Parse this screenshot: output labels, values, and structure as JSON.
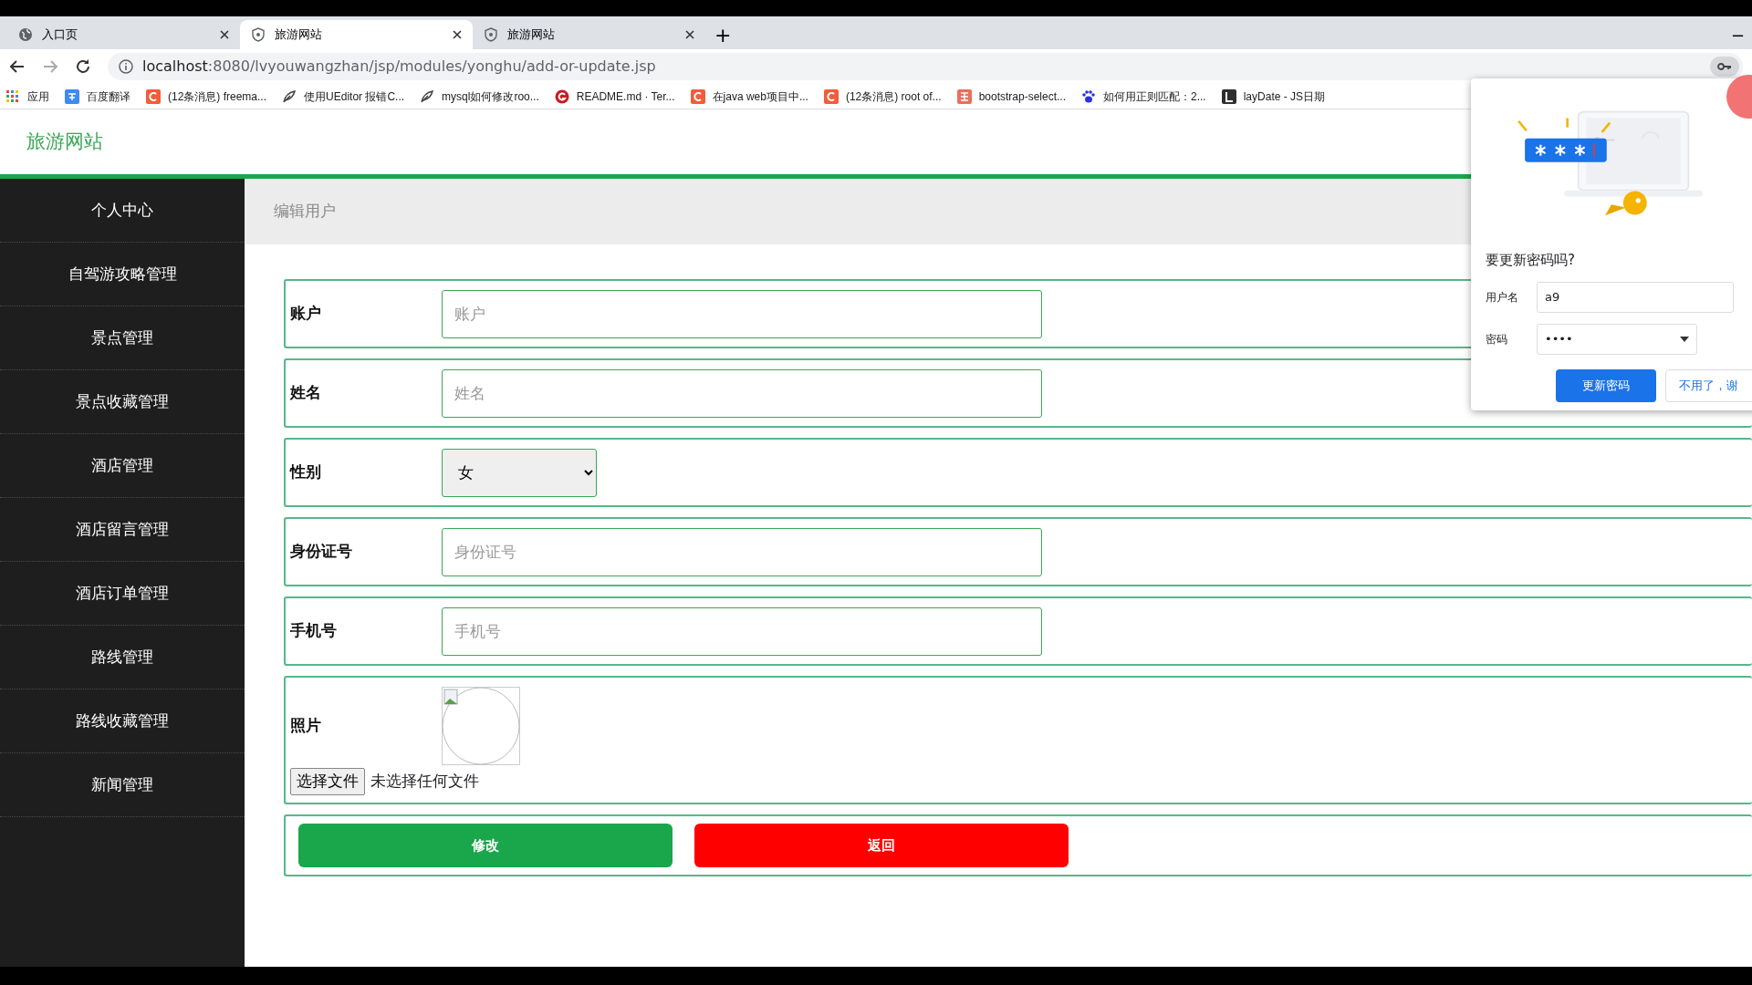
{
  "browser": {
    "tabs": [
      {
        "title": "入口页",
        "selected": false
      },
      {
        "title": "旅游网站",
        "selected": true
      },
      {
        "title": "旅游网站",
        "selected": false
      }
    ],
    "new_tab": "+",
    "minimize": "−",
    "url_host": "localhost",
    "url_rest": ":8080/lvyouwangzhan/jsp/modules/yonghu/add-or-update.jsp",
    "bookmarks": [
      {
        "title": "应用"
      },
      {
        "title": "百度翻译"
      },
      {
        "title": "(12条消息) freema..."
      },
      {
        "title": "使用UEditor 报错C..."
      },
      {
        "title": "mysql如何修改roo..."
      },
      {
        "title": "README.md · Ter..."
      },
      {
        "title": "在java web项目中..."
      },
      {
        "title": "(12条消息) root of..."
      },
      {
        "title": "bootstrap-select..."
      },
      {
        "title": "如何用正则匹配：2..."
      },
      {
        "title": "layDate - JS日期"
      }
    ]
  },
  "site_title": "旅游网站",
  "sidebar": {
    "items": [
      "个人中心",
      "自驾游攻略管理",
      "景点管理",
      "景点收藏管理",
      "酒店管理",
      "酒店留言管理",
      "酒店订单管理",
      "路线管理",
      "路线收藏管理",
      "新闻管理"
    ]
  },
  "breadcrumb": "编辑用户",
  "form": {
    "fields": [
      {
        "kind": "text",
        "label": "账户",
        "placeholder": "账户"
      },
      {
        "kind": "text",
        "label": "姓名",
        "placeholder": "姓名"
      },
      {
        "kind": "select",
        "label": "性别",
        "value": "女"
      },
      {
        "kind": "text",
        "label": "身份证号",
        "placeholder": "身份证号"
      },
      {
        "kind": "text",
        "label": "手机号",
        "placeholder": "手机号"
      },
      {
        "kind": "photo",
        "label": "照片",
        "button": "选择文件",
        "status": "未选择任何文件"
      }
    ],
    "buttons": [
      {
        "label": "修改",
        "kind": "submit"
      },
      {
        "label": "返回",
        "kind": "back"
      }
    ]
  },
  "password_popup": {
    "title": "要更新密码吗?",
    "username_label": "用户名",
    "username": "a9",
    "password_label": "密码",
    "password": "••••",
    "primary": "更新密码",
    "secondary": "不用了，谢"
  }
}
